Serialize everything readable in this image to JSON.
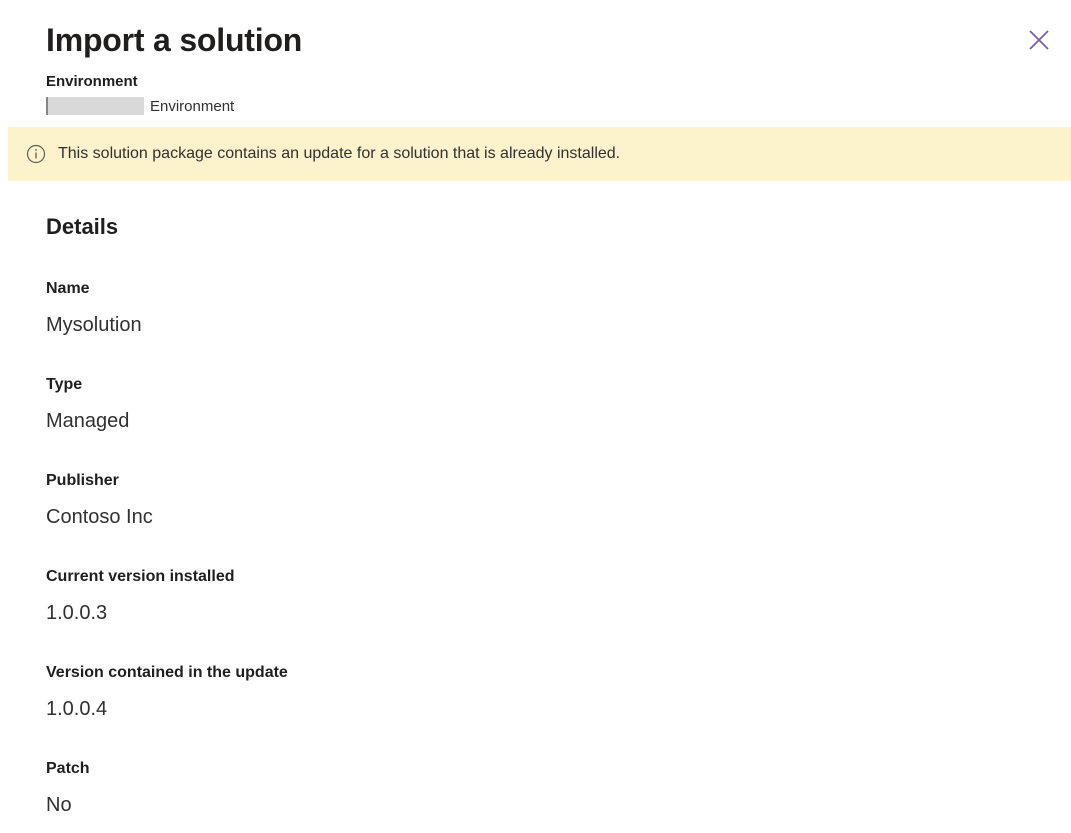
{
  "panel": {
    "title": "Import a solution",
    "close_icon": "close-icon"
  },
  "environment": {
    "label": "Environment",
    "value": "Environment"
  },
  "banner": {
    "icon": "info-icon",
    "message": "This solution package contains an update for a solution that is already installed.",
    "background_color": "#fcf2cc"
  },
  "details": {
    "heading": "Details",
    "fields": [
      {
        "label": "Name",
        "value": "Mysolution"
      },
      {
        "label": "Type",
        "value": "Managed"
      },
      {
        "label": "Publisher",
        "value": "Contoso Inc"
      },
      {
        "label": "Current version installed",
        "value": "1.0.0.3"
      },
      {
        "label": "Version contained in the update",
        "value": "1.0.0.4"
      },
      {
        "label": "Patch",
        "value": "No"
      }
    ]
  }
}
